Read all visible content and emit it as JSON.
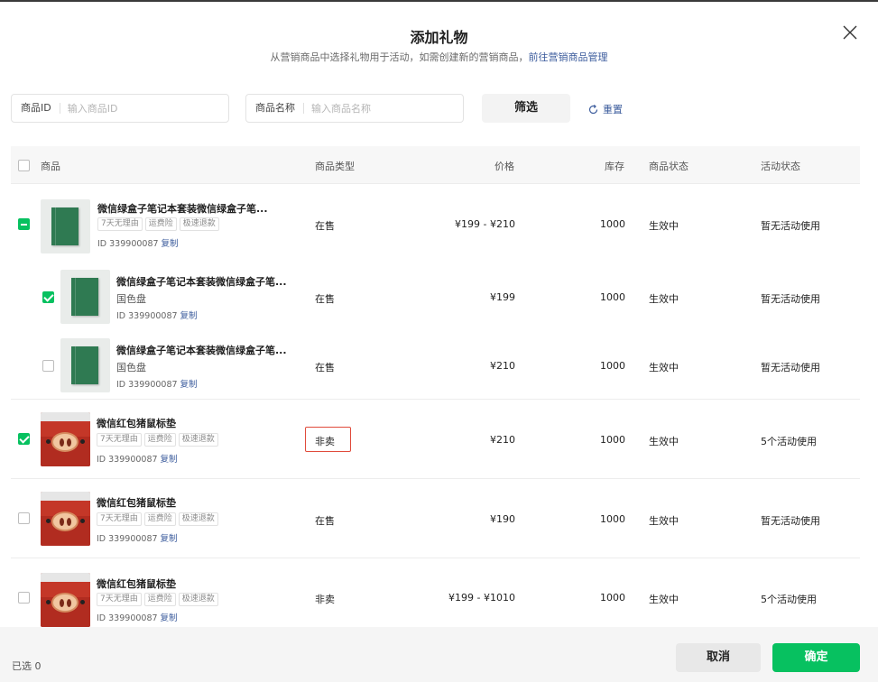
{
  "dialog": {
    "title": "添加礼物",
    "subtitle_text": "从营销商品中选择礼物用于活动，如需创建新的营销商品，",
    "subtitle_link": "前往营销商品管理",
    "close_icon": "close-icon"
  },
  "filters": {
    "id_label": "商品ID",
    "id_placeholder": "输入商品ID",
    "name_label": "商品名称",
    "name_placeholder": "输入商品名称",
    "filter_button": "筛选",
    "reset_button": "重置"
  },
  "table": {
    "headers": {
      "product": "商品",
      "type": "商品类型",
      "price": "价格",
      "stock": "库存",
      "status": "商品状态",
      "activity": "活动状态"
    },
    "rows": [
      {
        "name": "微信绿盒子笔记本套装微信绿盒子笔...",
        "tags": [
          "7天无理由",
          "运费险",
          "极速退款"
        ],
        "id_text": "ID 339900087",
        "copy": "复制",
        "type": "在售",
        "price": "¥199 - ¥210",
        "stock": "1000",
        "status": "生效中",
        "activity": "暂无活动使用",
        "checkbox": "indeterminate",
        "thumb": "green-notebook",
        "subrows": [
          {
            "name": "微信绿盒子笔记本套装微信绿盒子笔...",
            "spec": "国色盘",
            "id_text": "ID 339900087",
            "copy": "复制",
            "type": "在售",
            "price": "¥199",
            "stock": "1000",
            "status": "生效中",
            "activity": "暂无活动使用",
            "checkbox": "checked"
          },
          {
            "name": "微信绿盒子笔记本套装微信绿盒子笔...",
            "spec": "国色盘",
            "id_text": "ID 339900087",
            "copy": "复制",
            "type": "在售",
            "price": "¥210",
            "stock": "1000",
            "status": "生效中",
            "activity": "暂无活动使用",
            "checkbox": "unchecked"
          }
        ]
      },
      {
        "name": "微信红包猪鼠标垫",
        "tags": [
          "7天无理由",
          "运费险",
          "极速退款"
        ],
        "id_text": "ID 339900087",
        "copy": "复制",
        "type": "非卖",
        "price": "¥210",
        "stock": "1000",
        "status": "生效中",
        "activity": "5个活动使用",
        "checkbox": "checked",
        "thumb": "red-pig",
        "highlight_color": "#e04b3b"
      },
      {
        "name": "微信红包猪鼠标垫",
        "tags": [
          "7天无理由",
          "运费险",
          "极速退款"
        ],
        "id_text": "ID 339900087",
        "copy": "复制",
        "type": "在售",
        "price": "¥190",
        "stock": "1000",
        "status": "生效中",
        "activity": "暂无活动使用",
        "checkbox": "unchecked",
        "thumb": "red-pig"
      },
      {
        "name": "微信红包猪鼠标垫",
        "tags": [
          "7天无理由",
          "运费险",
          "极速退款"
        ],
        "id_text": "ID 339900087",
        "copy": "复制",
        "type": "非卖",
        "price": "¥199 - ¥1010",
        "stock": "1000",
        "status": "生效中",
        "activity": "5个活动使用",
        "checkbox": "unchecked",
        "thumb": "red-pig"
      }
    ]
  },
  "footer": {
    "selected": "已选 0",
    "cancel": "取消",
    "confirm": "确定"
  },
  "colors": {
    "primary": "#07c160",
    "link": "#3b5b9c",
    "highlight": "#e04b3b"
  }
}
